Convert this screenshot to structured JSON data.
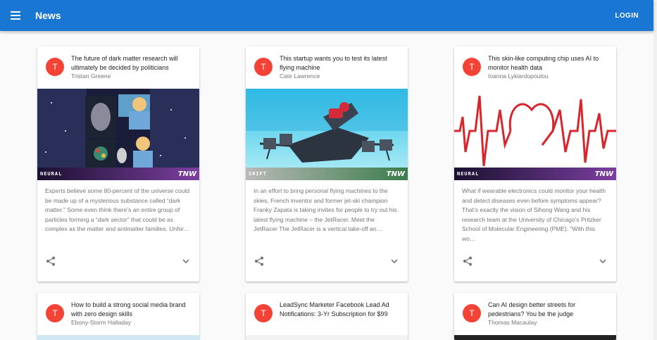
{
  "appbar": {
    "title": "News",
    "login_label": "LOGIN",
    "menu_icon": "menu-icon",
    "color": "#1976d2"
  },
  "cards": [
    {
      "title": "The future of dark matter research will ultimately be decided by politicians",
      "author": "Tristan Greene",
      "avatar": "T",
      "brand_left": "NEURAL",
      "brand_right": "TNW",
      "excerpt": "Experts believe some 80-percent of the universe could be made up of a mysterious substance called “dark matter.” Some even think there’s an entire group of particles forming a “dark sector” that could be as complex as the matter and antimatter families. Unfor…"
    },
    {
      "title": "This startup wants you to test its latest flying machine",
      "author": "Cate Lawrence",
      "avatar": "T",
      "brand_left": "SHIFT",
      "brand_right": "TNW",
      "excerpt": "In an effort to bring personal flying machines to the skies, French inventor and former jet-ski champion Franky Zapata is taking invites for people to try out his latest flying machine – the JetRacer.  Meet the JetRacer  The JetRacer is a vertical take-off an…"
    },
    {
      "title": "This skin-like computing chip uses AI to monitor health data",
      "author": "Ioanna Lykiardopoulou",
      "avatar": "T",
      "brand_left": "NEURAL",
      "brand_right": "TNW",
      "excerpt": "What if wearable electronics could monitor your health and detect diseases even before symptoms appear? That’s exactly the vision of Sihong Wang and his research team at the University of Chicago’s Pritzker School of Molecular Engineering (PME). “With this wo…"
    },
    {
      "title": "How to build a strong social media brand with zero design skills",
      "author": "Ebony-Storm Halladay",
      "avatar": "T"
    },
    {
      "title": "LeadSync Marketer Facebook Lead Ad Notifications: 3-Yr Subscription for $99",
      "author": "",
      "avatar": "T"
    },
    {
      "title": "Can AI design better streets for pedestrians? You be the judge",
      "author": "Thomas Macaulay",
      "avatar": "T"
    }
  ],
  "icons": {
    "share": "share-icon",
    "expand": "chevron-down-icon"
  }
}
